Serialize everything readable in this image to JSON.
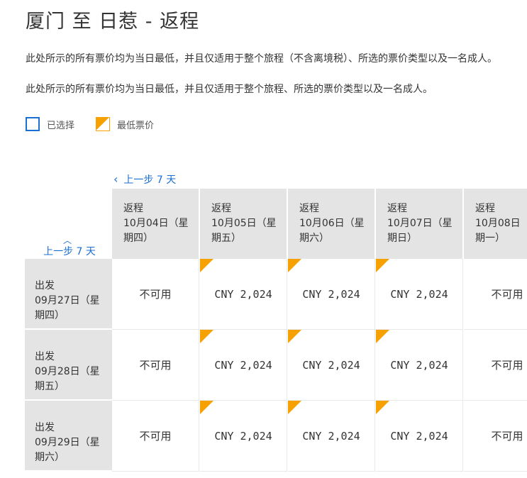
{
  "title": "厦门 至 日惹 - 返程",
  "notes": [
    "此处所示的所有票价均为当日最低，并且仅适用于整个旅程（不含离境税）、所选的票价类型以及一名成人。",
    "此处所示的所有票价均为当日最低，并且仅适用于整个旅程、所选的票价类型以及一名成人。"
  ],
  "legend": {
    "selected_label": "已选择",
    "lowest_label": "最低票价"
  },
  "nav": {
    "prev_top": "上一步 7 天",
    "prev_left": "上一步 7 天"
  },
  "columns": [
    {
      "label": "返程",
      "date": "10月04日（星期四）"
    },
    {
      "label": "返程",
      "date": "10月05日（星期五）"
    },
    {
      "label": "返程",
      "date": "10月06日（星期六）"
    },
    {
      "label": "返程",
      "date": "10月07日（星期日）"
    },
    {
      "label": "返程",
      "date": "10月08日（星期一）"
    }
  ],
  "rows": [
    {
      "label": "出发",
      "date": "09月27日（星期四）",
      "cells": [
        {
          "text": "不可用",
          "lowest": false
        },
        {
          "text": "CNY 2,024",
          "lowest": true
        },
        {
          "text": "CNY 2,024",
          "lowest": true
        },
        {
          "text": "CNY 2,024",
          "lowest": true
        },
        {
          "text": "不可用",
          "lowest": false
        }
      ]
    },
    {
      "label": "出发",
      "date": "09月28日（星期五）",
      "cells": [
        {
          "text": "不可用",
          "lowest": false
        },
        {
          "text": "CNY 2,024",
          "lowest": true
        },
        {
          "text": "CNY 2,024",
          "lowest": true
        },
        {
          "text": "CNY 2,024",
          "lowest": true
        },
        {
          "text": "不可用",
          "lowest": false
        }
      ]
    },
    {
      "label": "出发",
      "date": "09月29日（星期六）",
      "cells": [
        {
          "text": "不可用",
          "lowest": false
        },
        {
          "text": "CNY 2,024",
          "lowest": true
        },
        {
          "text": "CNY 2,024",
          "lowest": true
        },
        {
          "text": "CNY 2,024",
          "lowest": true
        },
        {
          "text": "不可用",
          "lowest": false
        }
      ]
    }
  ],
  "colors": {
    "accent": "#1a6fd2",
    "lowest_flag": "#f7a100",
    "header_bg": "#e4e4e4"
  }
}
